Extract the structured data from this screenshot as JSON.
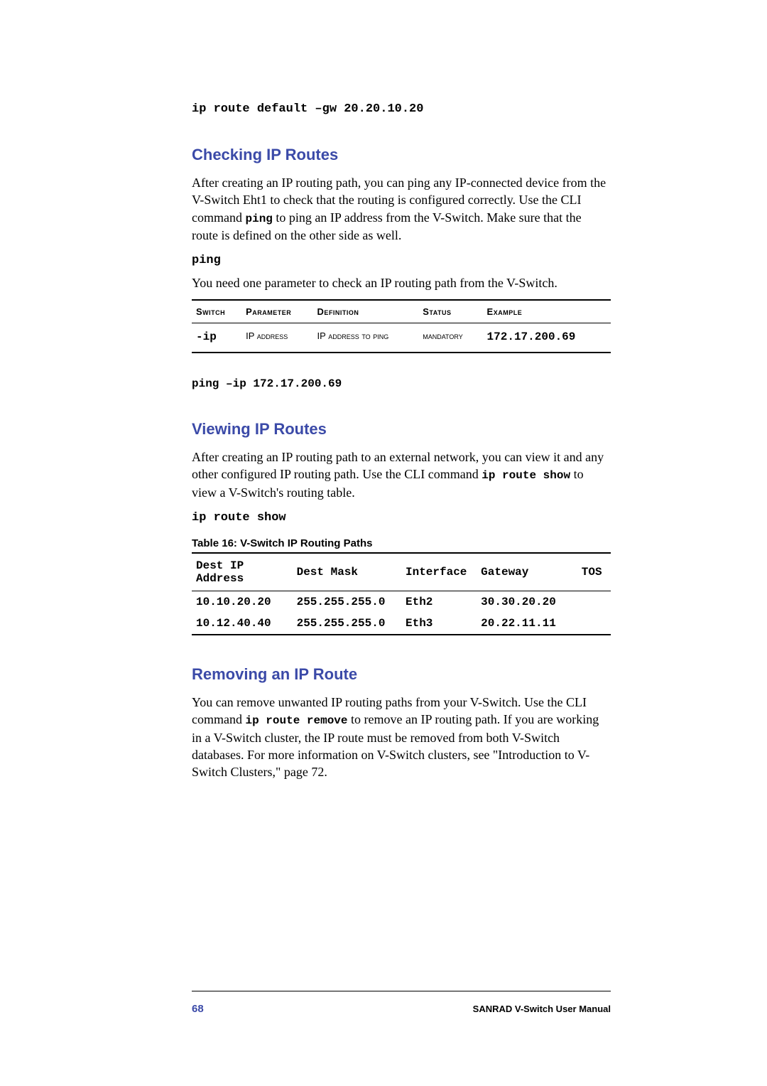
{
  "top_command": "ip route default –gw 20.20.10.20",
  "section1": {
    "heading": "Checking IP Routes",
    "para_before": "After creating an IP routing path, you can ping any IP-connected device from the V-Switch Eht1 to check that the routing is configured correctly. Use the CLI command ",
    "para_cmd": "ping",
    "para_after": " to ping an IP address from the V-Switch. Make sure that the route is defined on the other side as well.",
    "cmd_label": "ping",
    "para2": "You need one parameter to check an IP routing path from the V-Switch."
  },
  "tbl1": {
    "headers": [
      "Switch",
      "Parameter",
      "Definition",
      "Status",
      "Example"
    ],
    "row": {
      "switch": "-ip",
      "parameter": "IP address",
      "definition": "IP address to ping",
      "status": "mandatory",
      "example": "172.17.200.69"
    }
  },
  "section1_example": "ping –ip 172.17.200.69",
  "section2": {
    "heading": "Viewing IP Routes",
    "para_before": "After creating an IP routing path to an external network, you can view it and any other configured IP routing path.  Use the CLI command ",
    "para_cmd": "ip route show",
    "para_after": " to view a V-Switch's routing table.",
    "cmd_label": "ip route show",
    "table_caption": "Table  16:     V-Switch IP Routing Paths"
  },
  "tbl2": {
    "headers": [
      "Dest IP Address",
      "Dest Mask",
      "Interface",
      "Gateway",
      "TOS"
    ],
    "rows": [
      {
        "dest": "10.10.20.20",
        "mask": "255.255.255.0",
        "iface": "Eth2",
        "gw": "30.30.20.20",
        "tos": ""
      },
      {
        "dest": "10.12.40.40",
        "mask": "255.255.255.0",
        "iface": "Eth3",
        "gw": "20.22.11.11",
        "tos": ""
      }
    ]
  },
  "section3": {
    "heading": "Removing an IP Route",
    "para_before": "You can remove unwanted IP routing paths from your V-Switch.  Use the CLI command ",
    "para_cmd": "ip route remove",
    "para_after": " to remove an IP routing path.  If you are working in a V-Switch cluster, the IP route must be removed from both V-Switch databases.  For more information on V-Switch clusters, see \"Introduction to V-Switch Clusters,\" page 72."
  },
  "footer": {
    "page_number": "68",
    "manual_title": "SANRAD V-Switch User Manual"
  }
}
